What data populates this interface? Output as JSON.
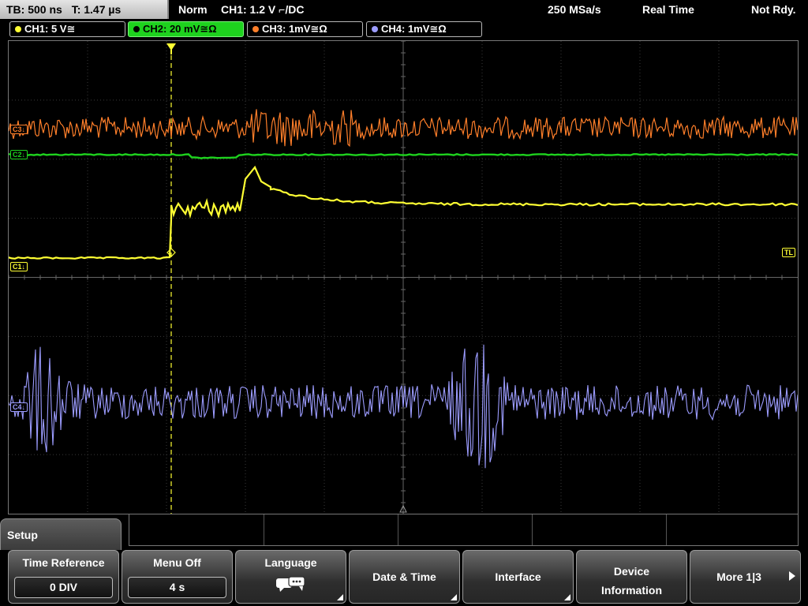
{
  "status": {
    "timebase": "TB: 500 ns",
    "trigger_time": "T: 1.47 µs",
    "mode": "Norm",
    "trigger": "CH1: 1.2 V ⌐/DC",
    "sample_rate": "250 MSa/s",
    "acq_mode": "Real Time",
    "state": "Not Rdy."
  },
  "channels": [
    {
      "label": "CH1: 5 V≅",
      "color": "#ffff33",
      "active": false
    },
    {
      "label": "CH2: 20 mV≅Ω",
      "color": "#1ed21e",
      "active": true
    },
    {
      "label": "CH3: 1mV≅Ω",
      "color": "#ff7f2a",
      "active": false
    },
    {
      "label": "CH4: 1mV≅Ω",
      "color": "#9c9cff",
      "active": false
    }
  ],
  "markers": {
    "trigger_level": "TL",
    "ch1": "C1↓",
    "ch2": "C2↓",
    "ch3": "C3↓",
    "ch4": "C4↓"
  },
  "menu": {
    "title": "Setup",
    "buttons": [
      {
        "label": "Time Reference",
        "value": "0 DIV"
      },
      {
        "label": "Menu Off",
        "value": "4 s"
      },
      {
        "label": "Language",
        "icon": "speech-bubbles-icon"
      },
      {
        "label": "Date & Time"
      },
      {
        "label": "Interface"
      },
      {
        "label": "Device\nInformation"
      },
      {
        "label": "More 1|3",
        "icon": "arrow-right-icon"
      }
    ]
  },
  "colors": {
    "ch1": "#ffff33",
    "ch2": "#1ed21e",
    "ch3": "#ff7f2a",
    "ch4": "#9c9cff",
    "trigger": "#ffff33"
  }
}
